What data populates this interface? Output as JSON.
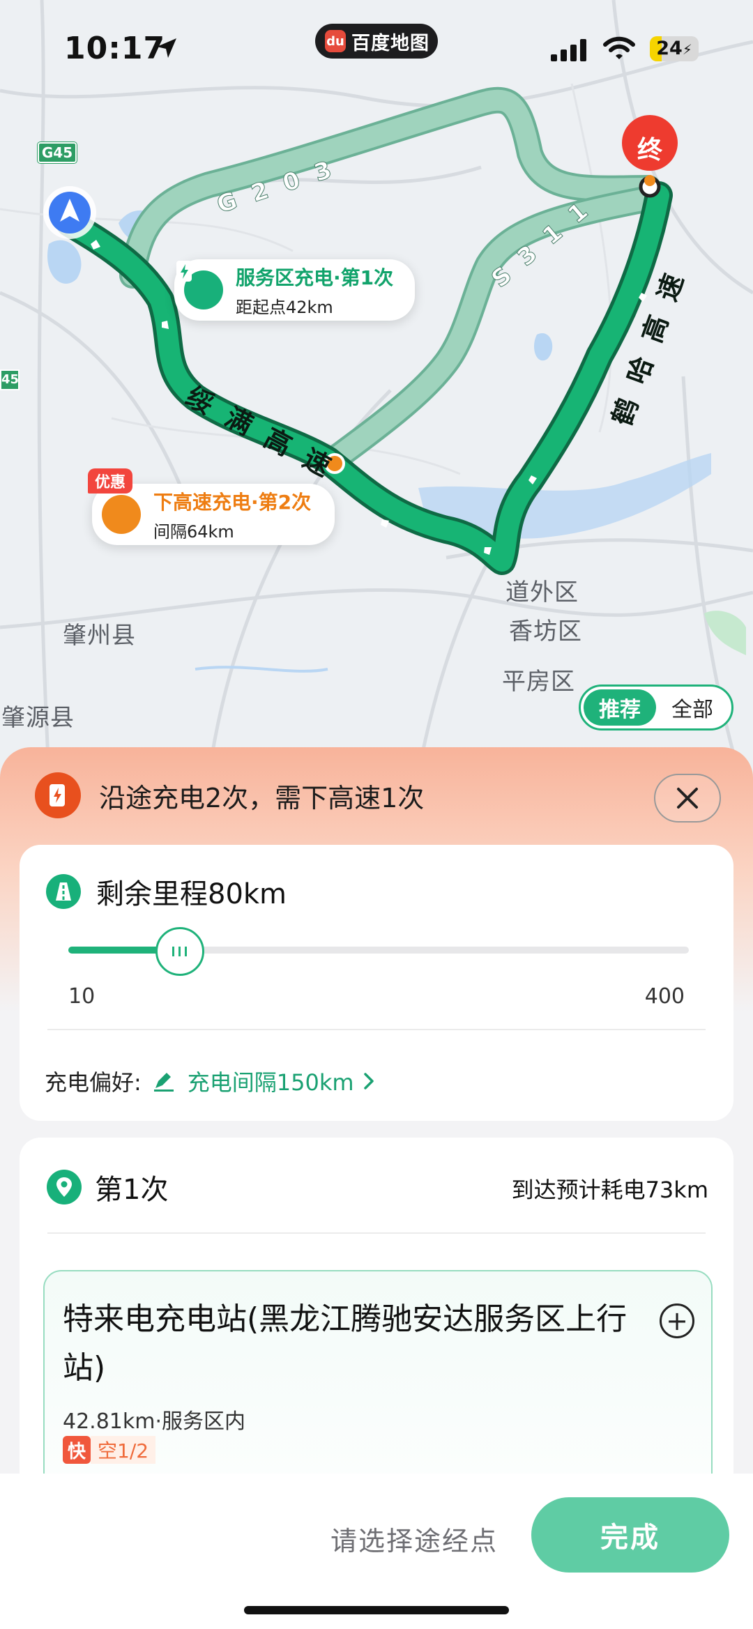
{
  "status": {
    "time": "10:17",
    "app_name": "百度地图",
    "battery": "24"
  },
  "map": {
    "road_labels": {
      "g45": "G45",
      "g45_left": "45",
      "g203": "G 2 0 3",
      "s311": "S 3 1 1",
      "suiman": "绥 满 高 速",
      "heha": "鹤 哈 高 速"
    },
    "end_marker": "终",
    "places": {
      "daowai": "道外区",
      "xiangfang": "香坊区",
      "pingfang": "平房区",
      "zhaozhou": "肇州县",
      "zhaoyuan": "肇源县"
    },
    "callout_service": {
      "title": "服务区充电·第1次",
      "sub": "距起点42km"
    },
    "callout_exit": {
      "promo": "优惠",
      "title": "下高速充电·第2次",
      "sub": "间隔64km"
    },
    "toggle": {
      "recommended": "推荐",
      "all": "全部"
    }
  },
  "sheet": {
    "header": "沿途充电2次，需下高速1次",
    "range": {
      "title": "剩余里程80km",
      "min": "10",
      "max": "400",
      "value": 80,
      "min_val": 10,
      "max_val": 400
    },
    "preference": {
      "label": "充电偏好:",
      "value": "充电间隔150km"
    },
    "stop": {
      "title": "第1次",
      "arrival": "到达预计耗电73km",
      "station_name": "特来电充电站(黑龙江腾驰安达服务区上行站)",
      "meta": "42.81km·服务区内",
      "tag_fast": "快",
      "tag_free": "空1/2"
    }
  },
  "footer": {
    "waypoint": "请选择途经点",
    "done": "完成"
  },
  "colors": {
    "route": "#17b474",
    "alt_route": "#9fd3bd",
    "accent": "#1fb27a",
    "exit": "#f08a1c",
    "end": "#ee3b2f"
  }
}
